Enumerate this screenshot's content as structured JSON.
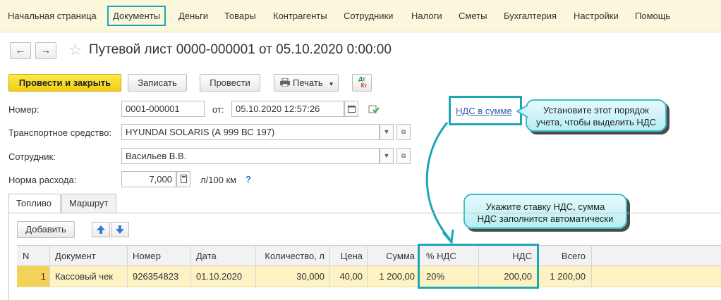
{
  "topmenu": {
    "items": [
      "Начальная страница",
      "Документы",
      "Деньги",
      "Товары",
      "Контрагенты",
      "Сотрудники",
      "Налоги",
      "Сметы",
      "Бухгалтерия",
      "Настройки",
      "Помощь"
    ]
  },
  "nav": {
    "back": "←",
    "forward": "→"
  },
  "title": "Путевой лист 0000-000001 от 05.10.2020 0:00:00",
  "toolbar": {
    "post_close": "Провести и закрыть",
    "save": "Записать",
    "post": "Провести",
    "print": "Печать",
    "dtkt_top": "Дт",
    "dtkt_bottom": "Кт"
  },
  "form": {
    "number_label": "Номер:",
    "number_value": "0001-000001",
    "date_label": "от:",
    "date_value": "05.10.2020 12:57:26",
    "vehicle_label": "Транспортное средство:",
    "vehicle_value": "HYUNDAI SOLARIS (А 999 ВС 197)",
    "employee_label": "Сотрудник:",
    "employee_value": "Васильев В.В.",
    "rate_label": "Норма расхода:",
    "rate_value": "7,000",
    "rate_unit": "л/100 км",
    "help": "?",
    "vat_link": "НДС в сумме"
  },
  "callouts": {
    "vat_order_line1": "Установите этот порядок",
    "vat_order_line2": "учета, чтобы выделить НДС",
    "vat_rate_line1": "Укажите ставку НДС, сумма",
    "vat_rate_line2": "НДС заполнится автоматически"
  },
  "tabs": [
    "Топливо",
    "Маршрут"
  ],
  "table_toolbar": {
    "add": "Добавить"
  },
  "table": {
    "headers": [
      "N",
      "Документ",
      "Номер",
      "Дата",
      "Количество, л",
      "Цена",
      "Сумма",
      "% НДС",
      "НДС",
      "Всего"
    ],
    "rows": [
      [
        "1",
        "Кассовый чек",
        "926354823",
        "01.10.2020",
        "30,000",
        "40,00",
        "1 200,00",
        "20%",
        "200,00",
        "1 200,00"
      ]
    ]
  },
  "colors": {
    "accent": "#1fa6b5",
    "primary_button": "#f5d422",
    "row_highlight": "#fcf2c2",
    "menu_bg": "#fbf7dc"
  }
}
